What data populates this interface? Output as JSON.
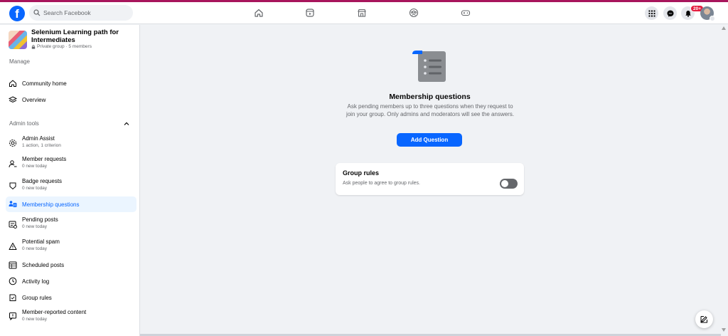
{
  "topbar": {
    "logo": "f",
    "search_placeholder": "Search Facebook",
    "nav_icons": [
      "home-icon",
      "video-icon",
      "marketplace-icon",
      "groups-icon",
      "gaming-icon"
    ],
    "notification_badge": "20+",
    "accent": "#0866ff"
  },
  "group": {
    "title": "Selenium Learning path for Intermediates",
    "meta": "Private group · 5 members"
  },
  "sidebar": {
    "manage_label": "Manage",
    "admin_tools_label": "Admin tools",
    "top_items": [
      {
        "label": "Community home",
        "icon": "home-icon"
      },
      {
        "label": "Overview",
        "icon": "overview-icon"
      }
    ],
    "admin_items": [
      {
        "label": "Admin Assist",
        "sub": "1 action, 1 criterion",
        "icon": "admin-assist-icon"
      },
      {
        "label": "Member requests",
        "sub": "0 new today",
        "icon": "member-requests-icon"
      },
      {
        "label": "Badge requests",
        "sub": "0 new today",
        "icon": "badge-icon"
      },
      {
        "label": "Membership questions",
        "sub": "",
        "icon": "membership-questions-icon",
        "active": true
      },
      {
        "label": "Pending posts",
        "sub": "0 new today",
        "icon": "pending-posts-icon"
      },
      {
        "label": "Potential spam",
        "sub": "0 new today",
        "icon": "warning-icon"
      },
      {
        "label": "Scheduled posts",
        "sub": "",
        "icon": "calendar-icon"
      },
      {
        "label": "Activity log",
        "sub": "",
        "icon": "clock-icon"
      },
      {
        "label": "Group rules",
        "sub": "",
        "icon": "rules-icon"
      },
      {
        "label": "Member-reported content",
        "sub": "0 new today",
        "icon": "reported-content-icon"
      }
    ]
  },
  "main": {
    "title": "Membership questions",
    "description": "Ask pending members up to three questions when they request to join your group. Only admins and moderators will see the answers.",
    "add_button": "Add Question",
    "rules_card": {
      "title": "Group rules",
      "description": "Ask people to agree to group rules.",
      "toggle_on": false
    }
  }
}
